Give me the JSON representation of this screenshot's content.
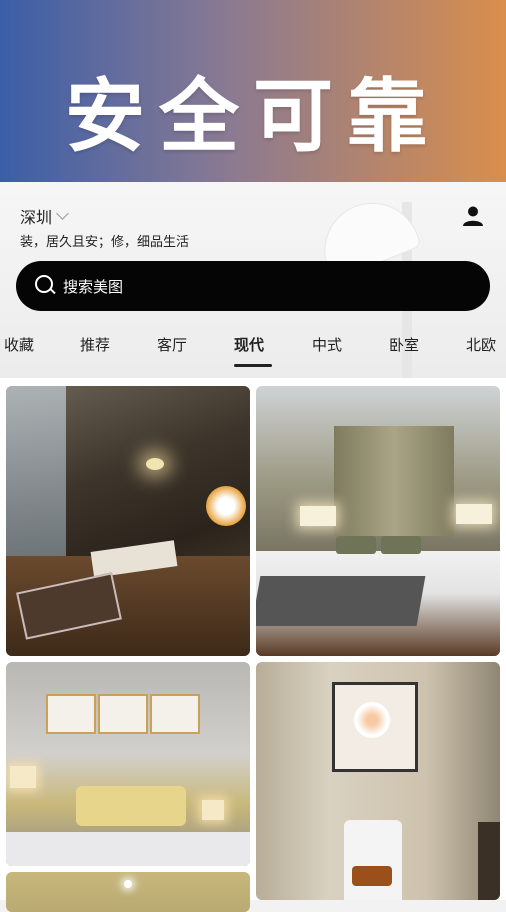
{
  "hero": {
    "title": "安全可靠"
  },
  "header": {
    "city": "深圳",
    "tagline": "装，居久且安；修，细品生活",
    "user_icon": "user-icon"
  },
  "search": {
    "placeholder": "搜索美图",
    "icon": "search-icon"
  },
  "tabs": [
    {
      "label": "收藏"
    },
    {
      "label": "推荐"
    },
    {
      "label": "客厅"
    },
    {
      "label": "现代",
      "active": true
    },
    {
      "label": "中式"
    },
    {
      "label": "卧室"
    },
    {
      "label": "北欧"
    }
  ],
  "gallery": {
    "items": [
      {
        "subject": "modern-study-room-image"
      },
      {
        "subject": "bedroom-with-violin-image"
      },
      {
        "subject": "bedroom-with-framed-art-image"
      },
      {
        "subject": "bathroom-with-painting-image"
      },
      {
        "subject": "ceiling-room-image"
      }
    ]
  }
}
